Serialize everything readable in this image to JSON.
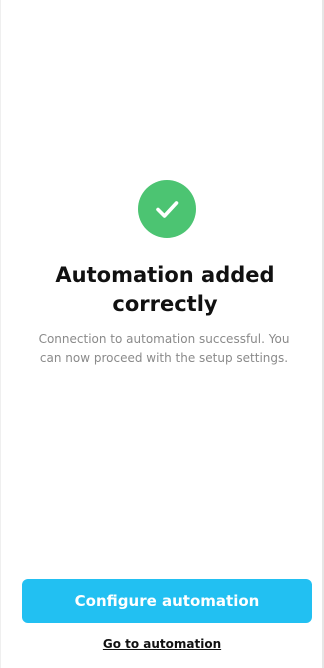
{
  "status": {
    "icon": "checkmark-icon",
    "icon_color": "#4cc472"
  },
  "main": {
    "title": "Automation added correctly",
    "message": "Connection to automation successful. You can now proceed with the setup settings."
  },
  "actions": {
    "primary_label": "Configure automation",
    "primary_color": "#22c0f2",
    "link_label": "Go to automation"
  }
}
